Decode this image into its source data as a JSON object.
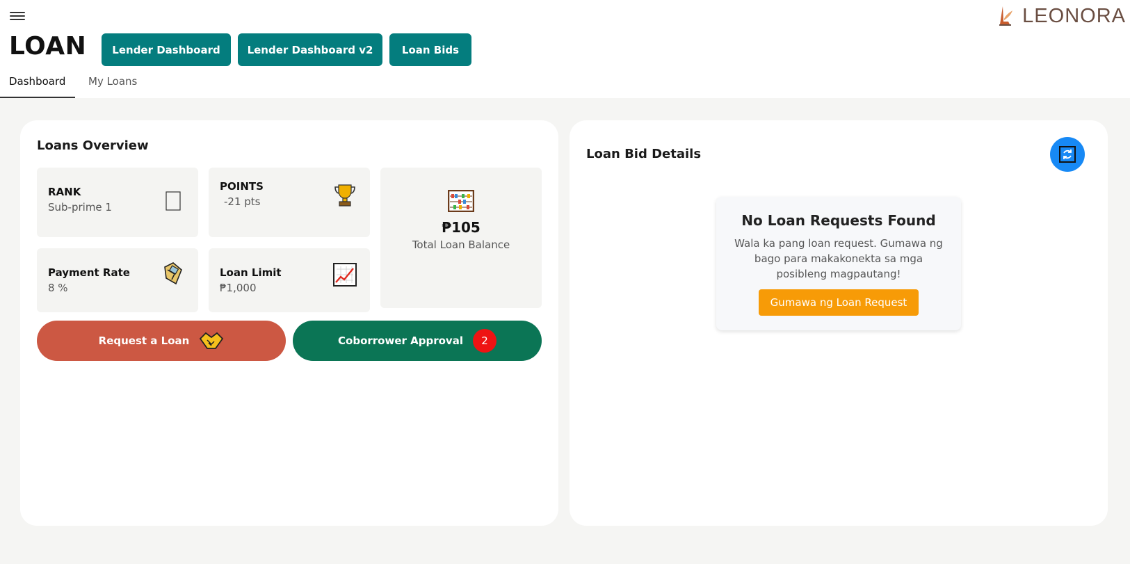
{
  "header": {
    "menu_icon": "hamburger-menu-icon",
    "page_title": "LOAN",
    "nav_buttons": [
      "Lender Dashboard",
      "Lender Dashboard v2",
      "Loan Bids"
    ],
    "logo": {
      "text": "LEONORA",
      "icon": "leonora-logo-icon"
    }
  },
  "tabs": [
    {
      "label": "Dashboard",
      "active": true
    },
    {
      "label": "My Loans",
      "active": false
    }
  ],
  "overview": {
    "title": "Loans Overview",
    "rank": {
      "label": "RANK",
      "value": "Sub-prime 1",
      "icon": "rank-icon"
    },
    "points": {
      "label": "POINTS",
      "value": "-21 pts",
      "icon": "trophy-icon"
    },
    "payment_rate": {
      "label": "Payment Rate",
      "value": "8 %",
      "icon": "payment-icon"
    },
    "loan_limit": {
      "label": "Loan Limit",
      "value": "₱1,000",
      "icon": "chart-increasing-icon"
    },
    "total": {
      "amount": "₱105",
      "label": "Total Loan Balance",
      "icon": "abacus-icon"
    },
    "request_button": "Request a Loan",
    "coborrower_button": "Coborrower Approval",
    "coborrower_count": "2"
  },
  "bids": {
    "title": "Loan Bid Details",
    "refresh_icon": "refresh-icon",
    "empty_title": "No Loan Requests Found",
    "empty_text": "Wala ka pang loan request. Gumawa ng bago para makakonekta sa mga posibleng magpautang!",
    "cta": "Gumawa ng Loan Request"
  },
  "colors": {
    "teal": "#047d7e",
    "request": "#cc5843",
    "coborrower": "#0b7555",
    "badge": "#ee1313",
    "refresh": "#1789f5",
    "cta": "#f79b07"
  }
}
